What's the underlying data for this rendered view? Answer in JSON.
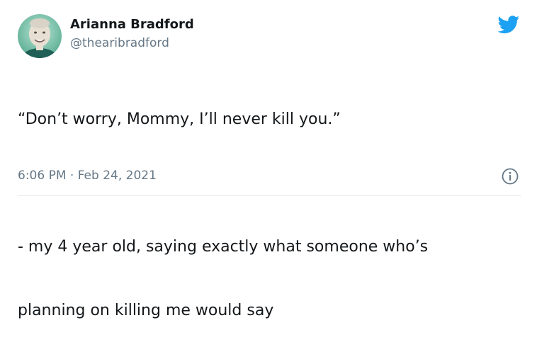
{
  "tweet": {
    "author": {
      "display_name": "Arianna Bradford",
      "handle": "@thearibradford",
      "avatar": "profile-photo"
    },
    "text_lines": [
      "“Don’t worry, Mommy, I’ll never kill you.”",
      "",
      "- my 4 year old, saying exactly what someone who’s",
      "planning on killing me would say"
    ],
    "timestamp": "6:06 PM · Feb 24, 2021",
    "icons": {
      "brand": "twitter-bird-icon",
      "info": "info-icon"
    }
  },
  "colors": {
    "twitter_blue": "#1da1f2",
    "text_primary": "#14171a",
    "text_secondary": "#657786",
    "divider": "#e1e8ed"
  }
}
